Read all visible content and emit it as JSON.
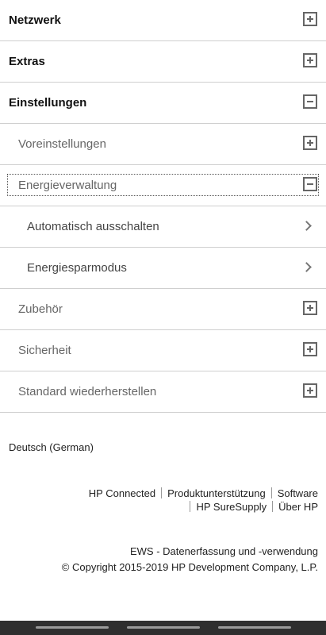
{
  "menu": {
    "network": "Netzwerk",
    "extras": "Extras",
    "settings": "Einstellungen",
    "presets": "Voreinstellungen",
    "energy": "Energieverwaltung",
    "auto_off": "Automatisch ausschalten",
    "sleep_mode": "Energiesparmodus",
    "accessories": "Zubehör",
    "security": "Sicherheit",
    "restore": "Standard wiederherstellen"
  },
  "language": "Deutsch (German)",
  "links": {
    "hp_connected": "HP Connected",
    "support": "Produktunterstützung",
    "software": "Software",
    "supply": "HP SureSupply",
    "about": "Über HP"
  },
  "footer": {
    "ews": "EWS - Datenerfassung und -verwendung",
    "copyright": "© Copyright 2015-2019 HP Development Company, L.P."
  },
  "icons": {
    "expand": "plus-box-icon",
    "collapse": "minus-box-icon",
    "navigate": "chevron-right-icon"
  }
}
